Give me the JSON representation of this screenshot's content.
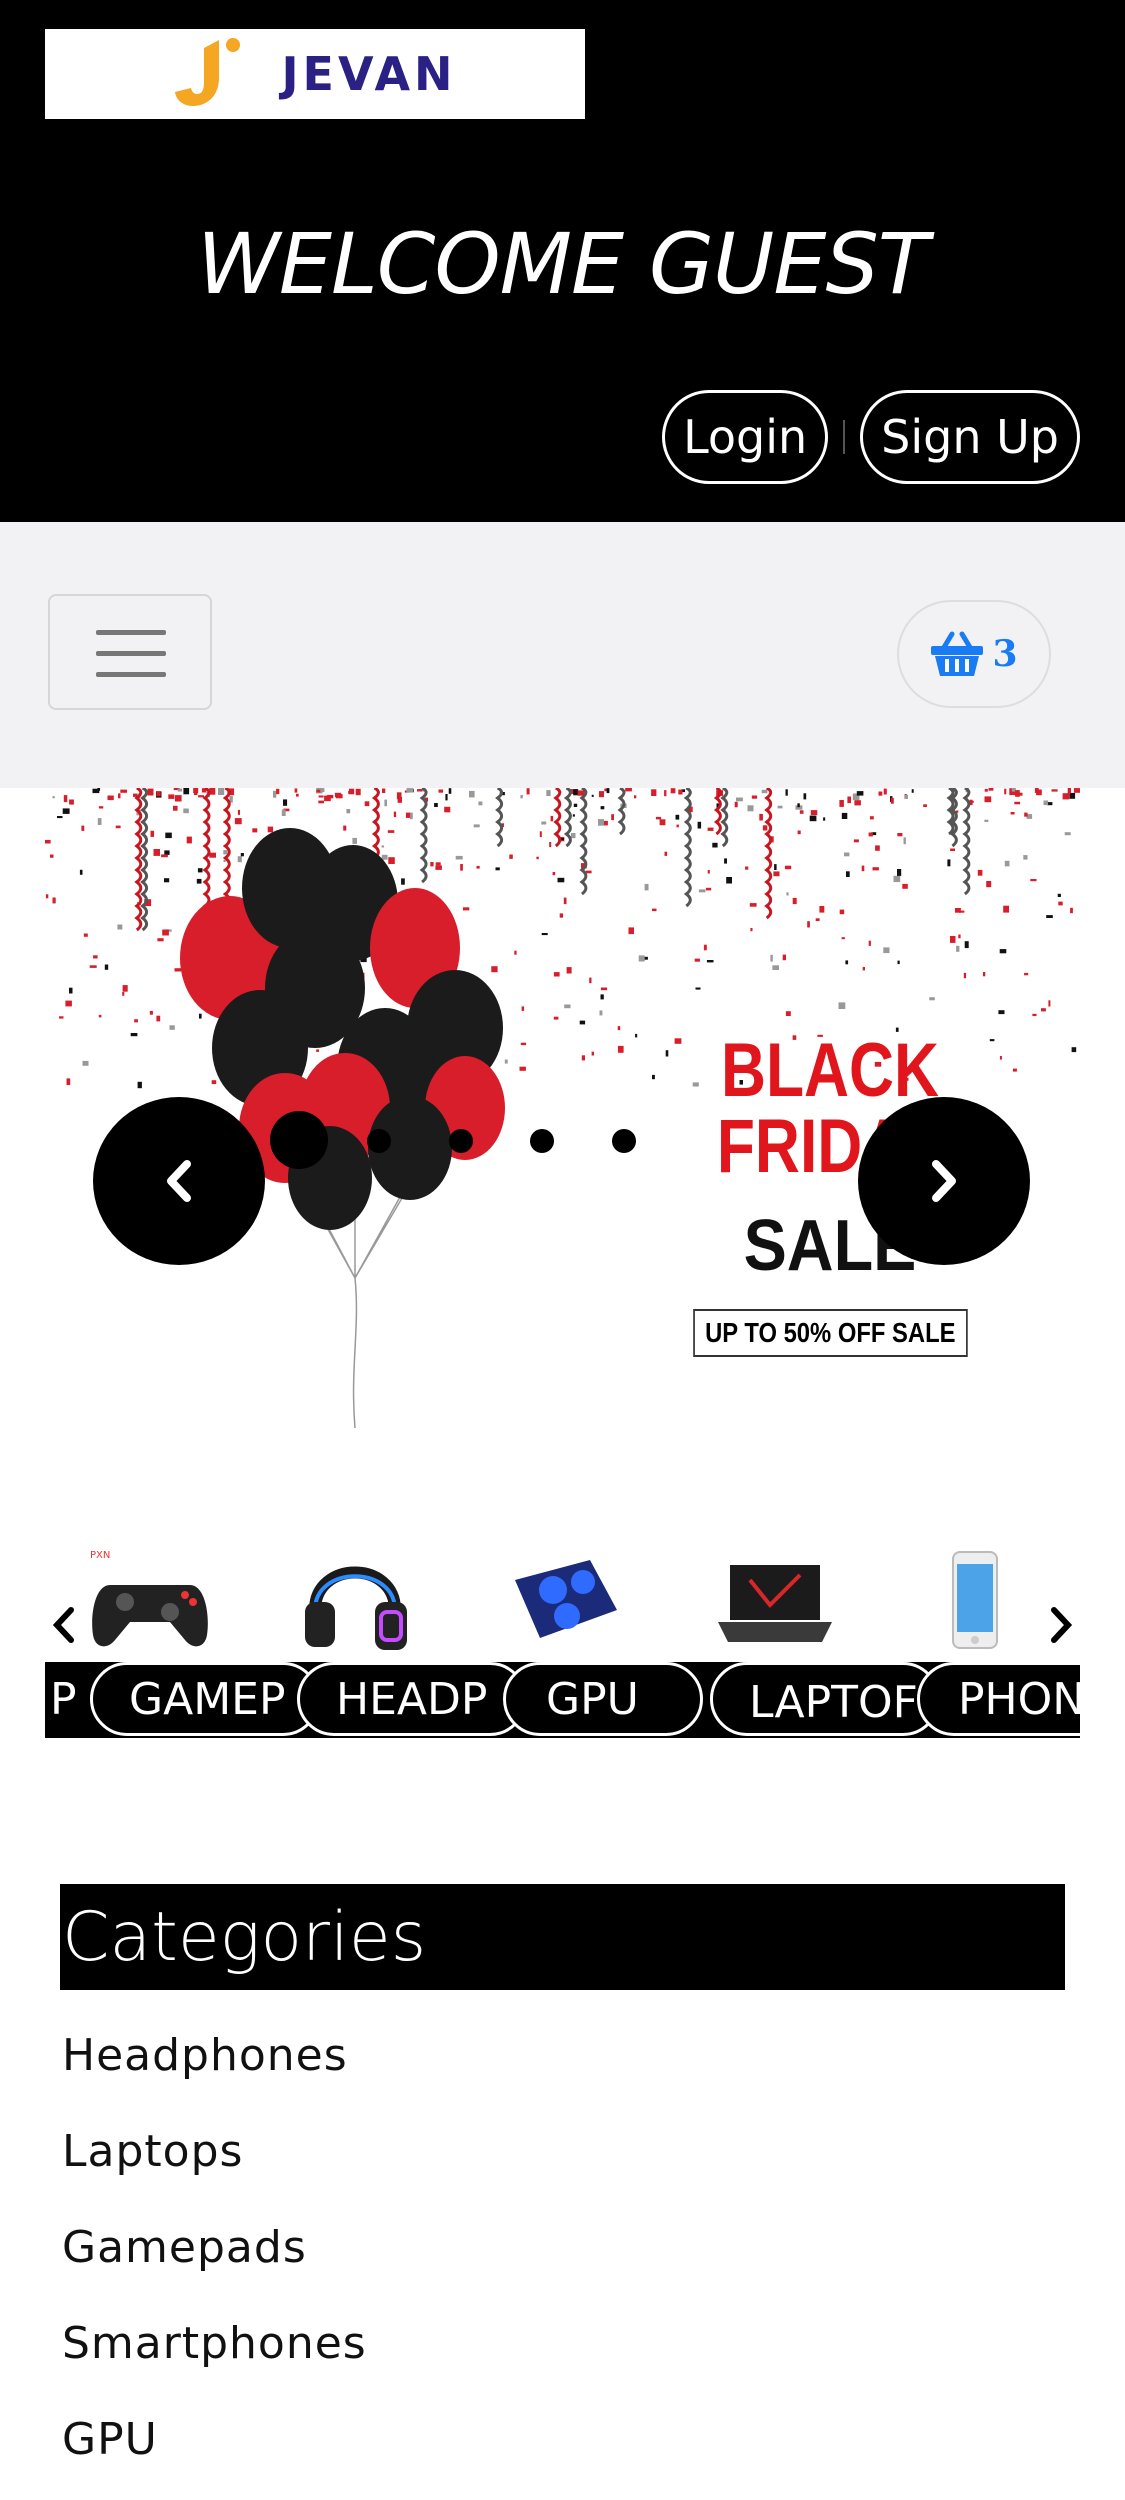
{
  "header": {
    "brand": "JEVAN",
    "welcome": "WELCOME GUEST",
    "login_label": "Login",
    "signup_label": "Sign Up"
  },
  "navbar": {
    "cart_count": "3",
    "cart_icon": "basket-icon",
    "menu_icon": "hamburger-icon"
  },
  "carousel": {
    "banner_line1": "BLACK",
    "banner_line2": "FRIDAY",
    "banner_line3": "SALE",
    "banner_offer": "UP TO 50% OFF SALE",
    "balloon_text": "BLACK FRIDAY SALE",
    "slide_count": 5,
    "active_slide": 1
  },
  "products": {
    "items": [
      {
        "label": "PC",
        "visible": "P"
      },
      {
        "label": "GAMEPADS",
        "visible": "GAMEP"
      },
      {
        "label": "HEADPHONES",
        "visible": "HEADP"
      },
      {
        "label": "GPU",
        "visible": "GPU"
      },
      {
        "label": "LAPTOPS",
        "visible": "LAPTOF"
      },
      {
        "label": "PHONES",
        "visible": "PHON"
      }
    ]
  },
  "categories": {
    "title": "Categories",
    "items": [
      "Headphones",
      "Laptops",
      "Gamepads",
      "Smartphones",
      "GPU"
    ]
  },
  "colors": {
    "header_bg": "#000000",
    "navbar_bg": "#f2f2f4",
    "cart_accent": "#1a7cf5",
    "brand_blue": "#2b2185",
    "brand_orange": "#f5a623",
    "sale_red": "#e0161c"
  }
}
